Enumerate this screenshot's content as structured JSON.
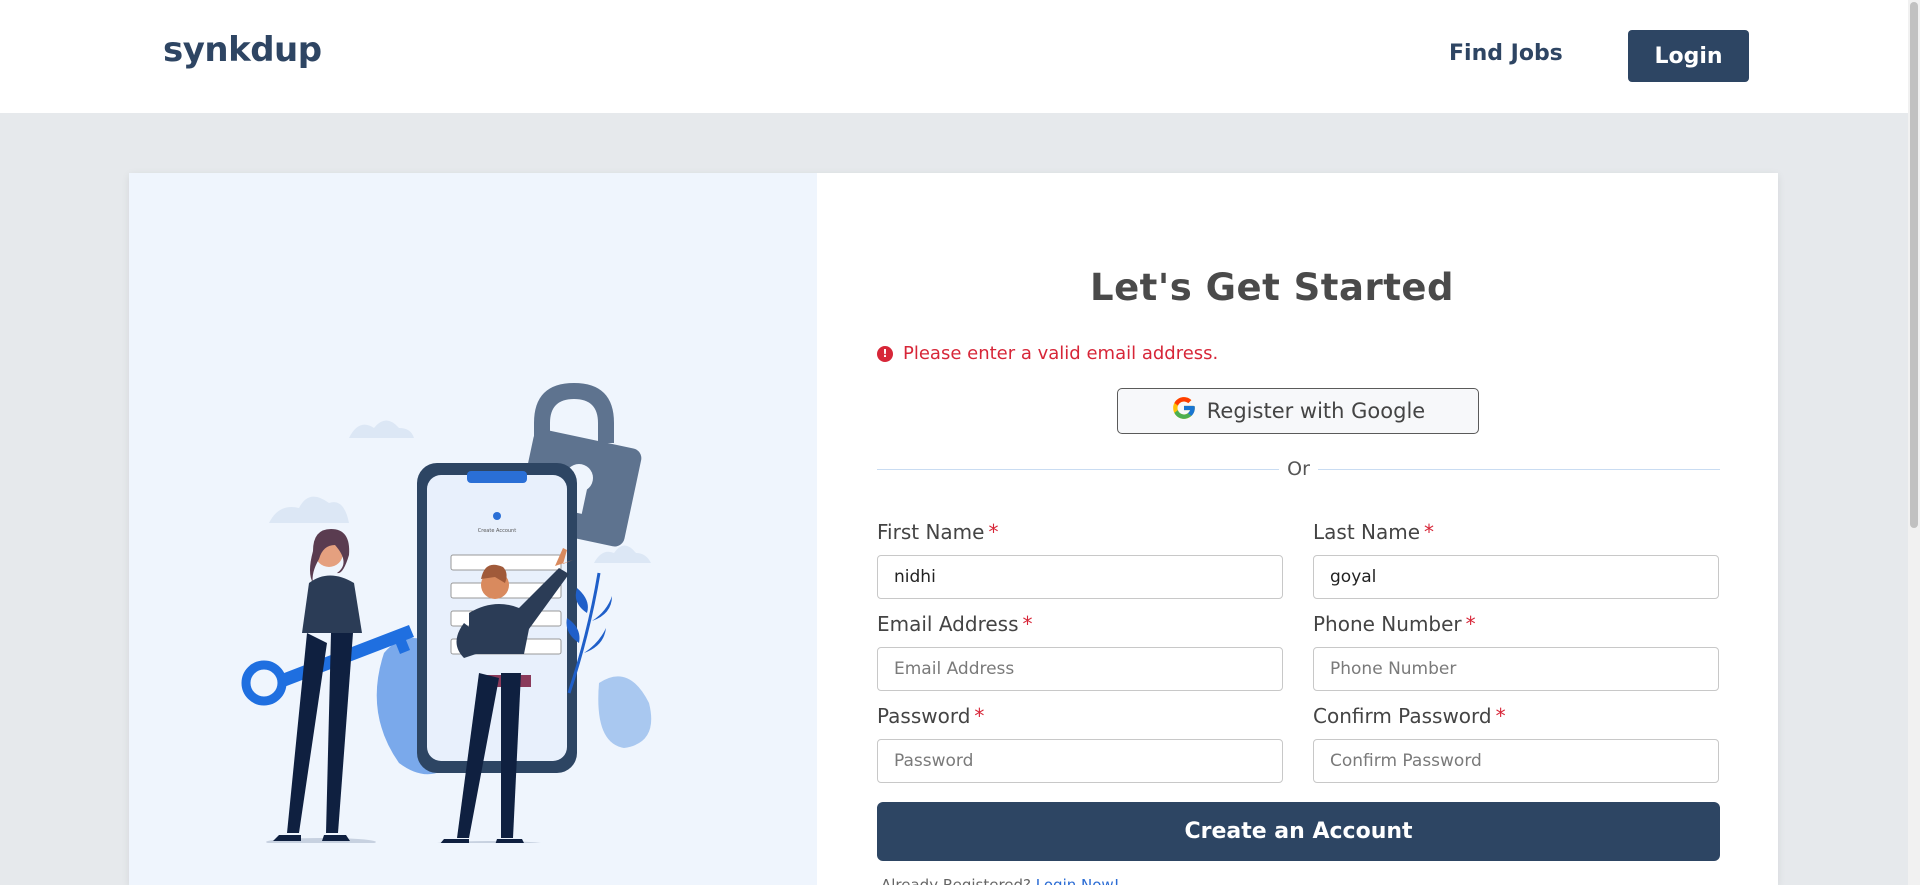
{
  "header": {
    "logo": "synkdup",
    "nav_find_jobs": "Find Jobs",
    "login_label": "Login"
  },
  "form": {
    "title": "Let's Get Started",
    "error_message": "Please enter a valid email address.",
    "google_button_label": "Register with Google",
    "divider_text": "Or",
    "required_mark": "*",
    "fields": {
      "first_name": {
        "label": "First Name",
        "value": "nidhi",
        "placeholder": ""
      },
      "last_name": {
        "label": "Last Name",
        "value": "goyal",
        "placeholder": ""
      },
      "email": {
        "label": "Email Address",
        "value": "",
        "placeholder": "Email Address"
      },
      "phone": {
        "label": "Phone Number",
        "value": "",
        "placeholder": "Phone Number"
      },
      "password": {
        "label": "Password",
        "value": "",
        "placeholder": "Password"
      },
      "confirm_password": {
        "label": "Confirm Password",
        "value": "",
        "placeholder": "Confirm Password"
      }
    },
    "submit_label": "Create an Account",
    "already_text": "Already Registered?",
    "login_now_link": "Login Now!"
  },
  "illustration": {
    "mini_form_title": "Create Account"
  },
  "colors": {
    "primary": "#2d4563",
    "error": "#d72638",
    "accent_blue": "#1f6fe0",
    "panel_bg": "#eff5fd"
  },
  "icons": [
    "error-circle-icon",
    "google-icon",
    "lock-icon",
    "key-icon"
  ]
}
